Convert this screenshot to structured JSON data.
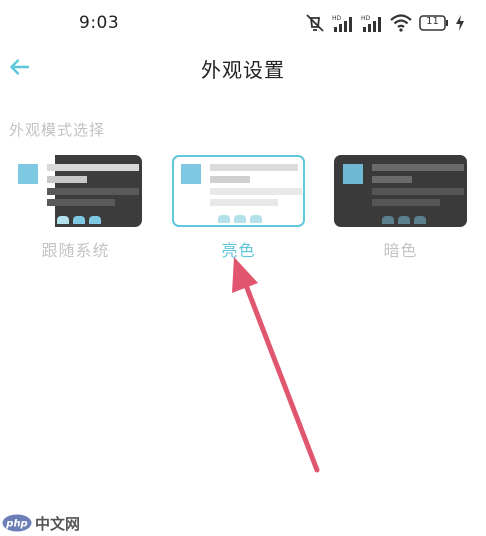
{
  "status_bar": {
    "time": "9:03",
    "icons": [
      "mute-icon",
      "signal-hd-icon",
      "signal-hd-icon",
      "wifi-icon",
      "battery-icon",
      "charging-icon"
    ],
    "battery_level": "11",
    "network_label": "HD"
  },
  "header": {
    "back_icon": "arrow-left-icon",
    "title": "外观设置"
  },
  "section": {
    "label": "外观模式选择"
  },
  "options": [
    {
      "label": "跟随系统",
      "selected": false
    },
    {
      "label": "亮色",
      "selected": true
    },
    {
      "label": "暗色",
      "selected": false
    }
  ],
  "colors": {
    "accent": "#5fc7da",
    "thumb": "#7ec8e3",
    "arrow": "#e0566f",
    "dark_card": "#3a3a3a",
    "muted_text": "#c2c2c2"
  },
  "watermark": {
    "logo_text": "php",
    "text": "中文网"
  }
}
